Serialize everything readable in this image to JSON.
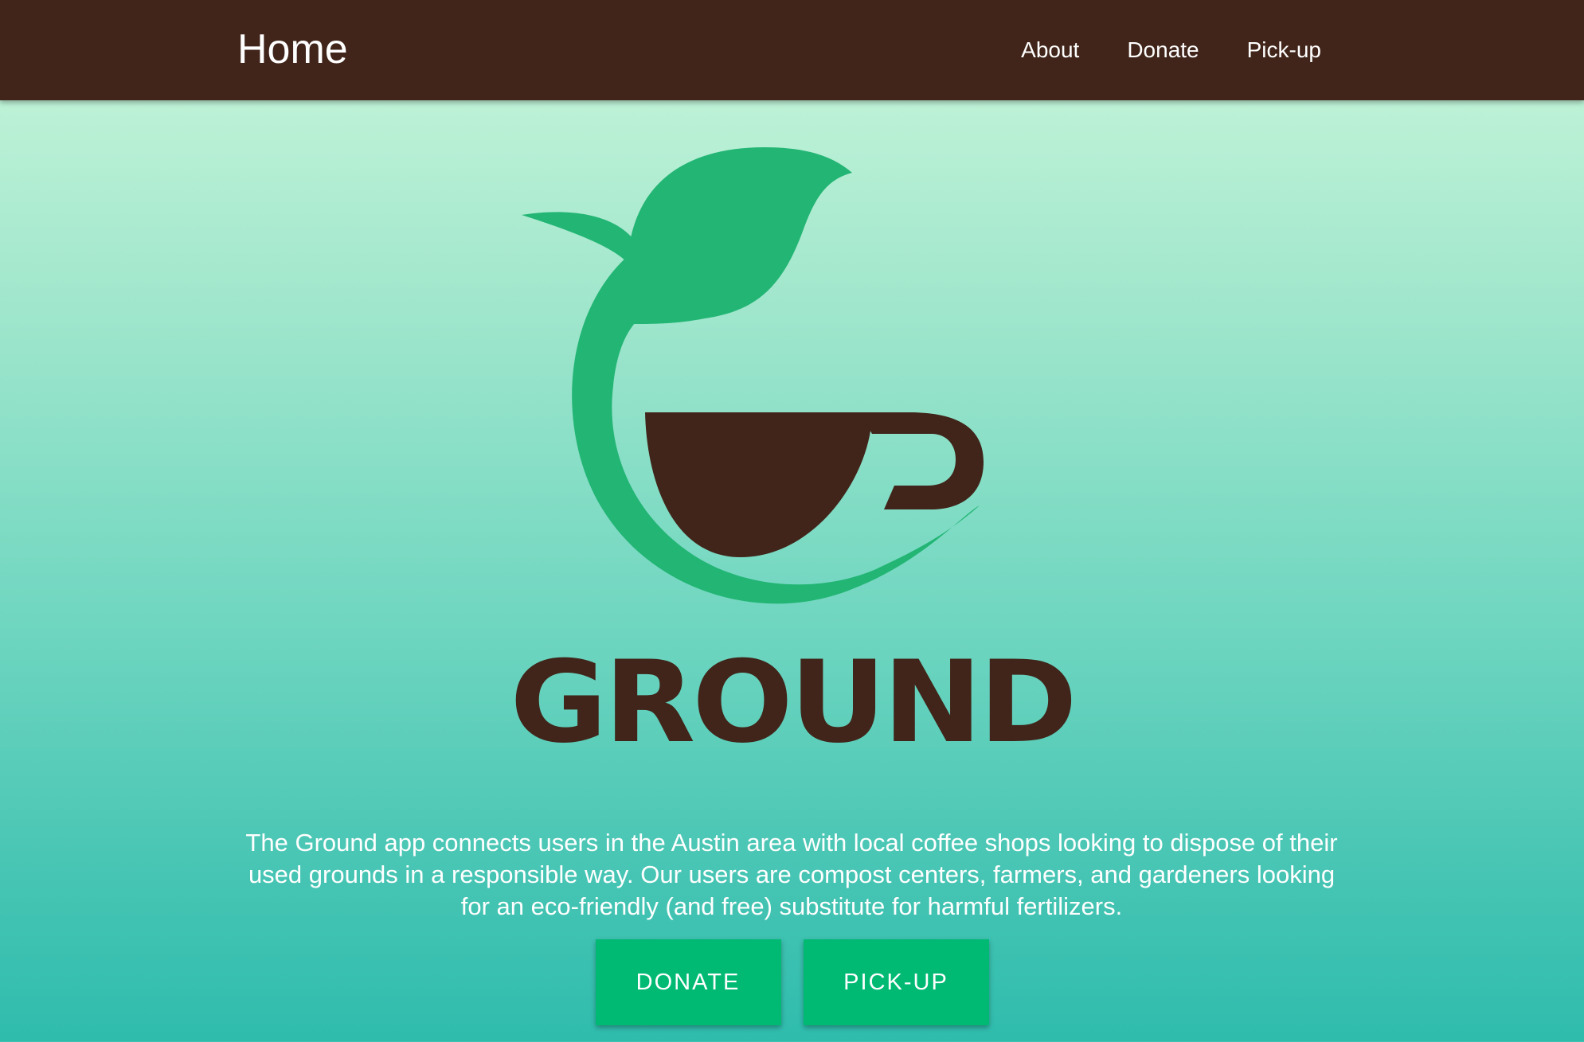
{
  "nav": {
    "brand": "Home",
    "links": [
      "About",
      "Donate",
      "Pick-up"
    ]
  },
  "hero": {
    "logo_icon": "leaf-coffee-cup-logo",
    "logo_wordmark": "GROUND",
    "description": "The Ground app connects users in the Austin area with local coffee shops looking to dispose of their used grounds in a responsible way. Our users are compost centers, farmers, and gardeners looking for an eco-friendly (and free) substitute for harmful fertilizers.",
    "buttons": {
      "donate": "DONATE",
      "pickup": "PICK-UP"
    }
  },
  "colors": {
    "navbar": "#41251a",
    "leaf_green": "#22b574",
    "cup_brown": "#41251a",
    "button": "#00ba74",
    "gradient_top": "#cbf7db",
    "gradient_bottom": "#2fbcad"
  }
}
